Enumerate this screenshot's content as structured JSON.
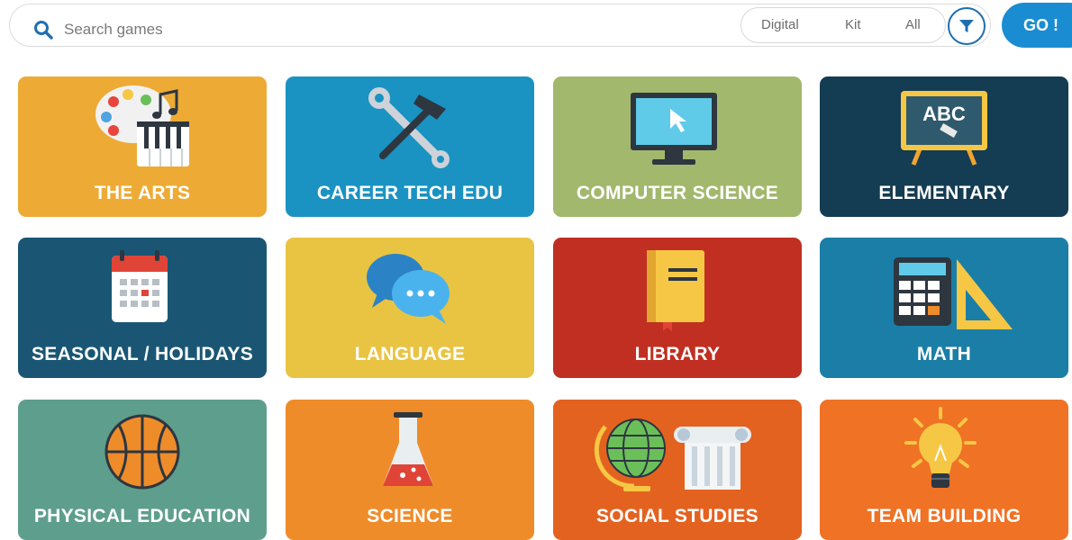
{
  "search": {
    "placeholder": "Search games"
  },
  "filters": {
    "options": [
      "Digital",
      "Kit",
      "All"
    ]
  },
  "go_label": "GO !",
  "colors": {
    "accent": "#1a8cd2",
    "arts": "#edab35",
    "career": "#1a93c2",
    "cs": "#a2b86d",
    "elementary": "#143c52",
    "seasonal": "#1a5674",
    "language": "#e9c443",
    "library": "#c02f21",
    "math": "#1a7ea6",
    "pe": "#5e9e8c",
    "science": "#ef8c2a",
    "social": "#e4621f",
    "team": "#ef7225"
  },
  "categories": [
    {
      "label": "THE ARTS",
      "icon": "palette-piano-icon"
    },
    {
      "label": "CAREER TECH EDU",
      "icon": "wrench-hammer-icon"
    },
    {
      "label": "COMPUTER SCIENCE",
      "icon": "monitor-cursor-icon"
    },
    {
      "label": "ELEMENTARY",
      "icon": "chalkboard-abc-icon",
      "icon_text": "ABC"
    },
    {
      "label": "SEASONAL / HOLIDAYS",
      "icon": "calendar-icon"
    },
    {
      "label": "LANGUAGE",
      "icon": "speech-bubbles-icon"
    },
    {
      "label": "LIBRARY",
      "icon": "book-icon"
    },
    {
      "label": "MATH",
      "icon": "calculator-ruler-icon"
    },
    {
      "label": "PHYSICAL EDUCATION",
      "icon": "basketball-icon"
    },
    {
      "label": "SCIENCE",
      "icon": "flask-icon"
    },
    {
      "label": "SOCIAL STUDIES",
      "icon": "globe-column-icon"
    },
    {
      "label": "TEAM BUILDING",
      "icon": "lightbulb-icon"
    }
  ]
}
